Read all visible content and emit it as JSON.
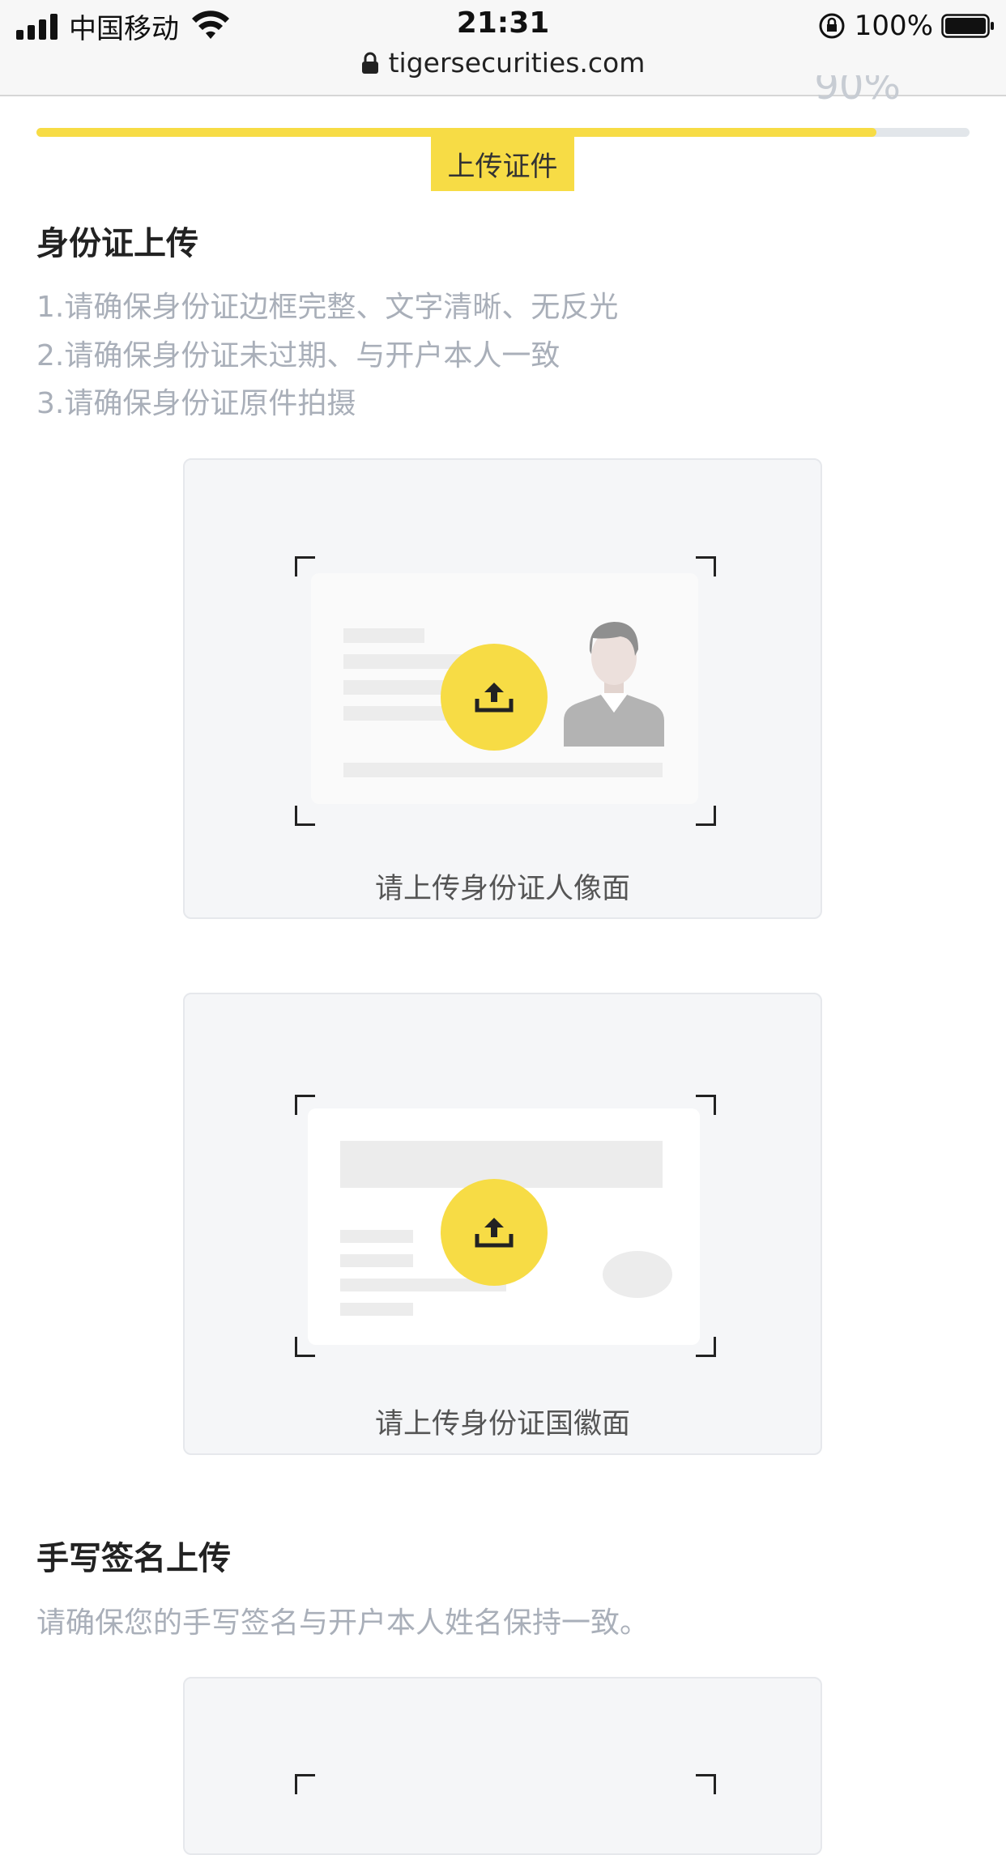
{
  "status_bar": {
    "carrier": "中国移动",
    "time": "21:31",
    "battery": "100%",
    "url": "tigersecurities.com"
  },
  "progress": {
    "percent_text": "90%",
    "value": 0.9,
    "step_label": "上传证件"
  },
  "id_section": {
    "title": "身份证上传",
    "tips": [
      "1.请确保身份证边框完整、文字清晰、无反光",
      "2.请确保身份证未过期、与开户本人一致",
      "3.请确保身份证原件拍摄"
    ],
    "front_label": "请上传身份证人像面",
    "back_label": "请上传身份证国徽面"
  },
  "signature_section": {
    "title": "手写签名上传",
    "tip": "请确保您的手写签名与开户本人姓名保持一致。"
  },
  "colors": {
    "accent": "#f7dc45",
    "card_bg": "#f5f6f8",
    "tip_text": "#a9afb9"
  }
}
